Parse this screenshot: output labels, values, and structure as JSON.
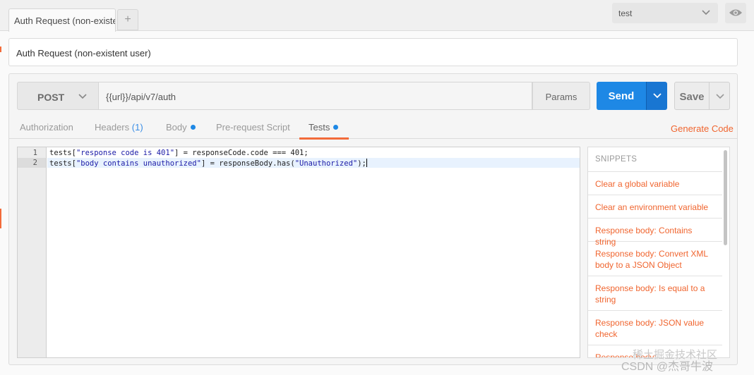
{
  "tab": {
    "title": "Auth Request (non-existe",
    "add_label": "+"
  },
  "environment": {
    "selected": "test"
  },
  "request": {
    "name": "Auth Request (non-existent user)",
    "method": "POST",
    "url": "{{url}}/api/v7/auth",
    "params_label": "Params",
    "send_label": "Send",
    "save_label": "Save"
  },
  "subtabs": {
    "authorization": "Authorization",
    "headers": "Headers",
    "headers_count": "(1)",
    "body": "Body",
    "pre_request": "Pre-request Script",
    "tests": "Tests",
    "generate_code": "Generate Code"
  },
  "editor": {
    "line_numbers": [
      "1",
      "2"
    ],
    "lines": [
      {
        "pre": "tests[",
        "str": "\"response code is 401\"",
        "post": "] = responseCode.code === 401;"
      },
      {
        "pre": "tests[",
        "str": "\"body contains unauthorized\"",
        "post": "] = responseBody.has(",
        "str2": "\"Unauthorized\"",
        "post2": ");"
      }
    ]
  },
  "snippets": {
    "title": "SNIPPETS",
    "items": [
      "Clear a global variable",
      "Clear an environment variable",
      "Response body: Contains string",
      "Response body: Convert XML body to a JSON Object",
      "Response body: Is equal to a string",
      "Response body: JSON value check",
      "Response body: ..."
    ]
  },
  "watermark": {
    "text1": "稀土掘金技术社区",
    "text2": "CSDN @杰哥牛波"
  },
  "colors": {
    "accent": "#f26b3a",
    "send": "#1e88e5",
    "link": "#f0652f"
  }
}
